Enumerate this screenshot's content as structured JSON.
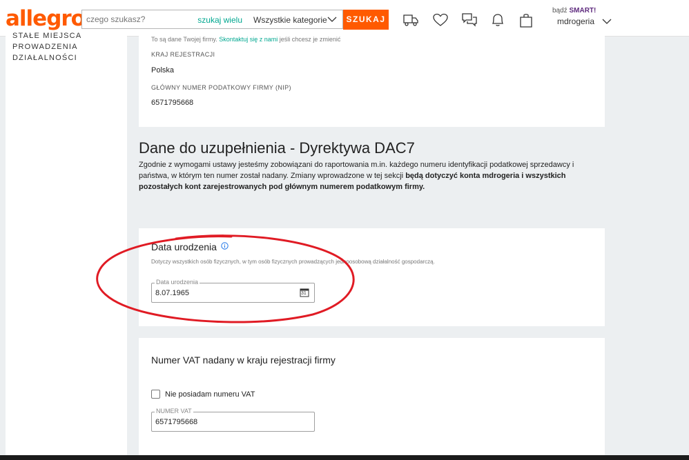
{
  "header": {
    "logo": "allegro",
    "search_placeholder": "czego szukasz?",
    "search_many": "szukaj wielu",
    "category": "Wszystkie kategorie",
    "search_button": "SZUKAJ",
    "smart_prefix": "bądź",
    "smart_label": "SMART!",
    "user": "mdrogeria"
  },
  "sidebar": {
    "label": "STAŁE MIEJSCA PROWADZENIA DZIAŁALNOŚCI"
  },
  "company": {
    "note_prefix": "To są dane Twojej firmy.",
    "note_link": "Skontaktuj się z nami",
    "note_suffix": "jeśli chcesz je zmienić",
    "country_label": "KRAJ REJESTRACJI",
    "country_value": "Polska",
    "nip_label": "GŁÓWNY NUMER PODATKOWY FIRMY (NIP)",
    "nip_value": "6571795668"
  },
  "dac7": {
    "title": "Dane do uzupełnienia - Dyrektywa DAC7",
    "desc_normal": "Zgodnie z wymogami ustawy jesteśmy zobowiązani do raportowania m.in. każdego numeru identyfikacji podatkowej sprzedawcy i państwa, w którym ten numer został nadany. Zmiany wprowadzone w tej sekcji",
    "desc_bold": "będą dotyczyć konta mdrogeria i wszystkich pozostałych kont zarejestrowanych pod głównym numerem podatkowym firmy."
  },
  "birthdate": {
    "title": "Data urodzenia",
    "note": "Dotyczy wszystkich osób fizycznych, w tym osób fizycznych prowadzących jednoosobową działalność gospodarczą.",
    "field_label": "Data urodzenia",
    "field_value": "8.07.1965",
    "calendar_day": "31"
  },
  "vat": {
    "title": "Numer VAT nadany w kraju rejestracji firmy",
    "checkbox_label": "Nie posiadam numeru VAT",
    "field_label": "NUMER VAT",
    "field_value": "6571795668"
  },
  "colors": {
    "brand": "#ff5a00",
    "link": "#00a790",
    "annotation": "#e01b24"
  }
}
